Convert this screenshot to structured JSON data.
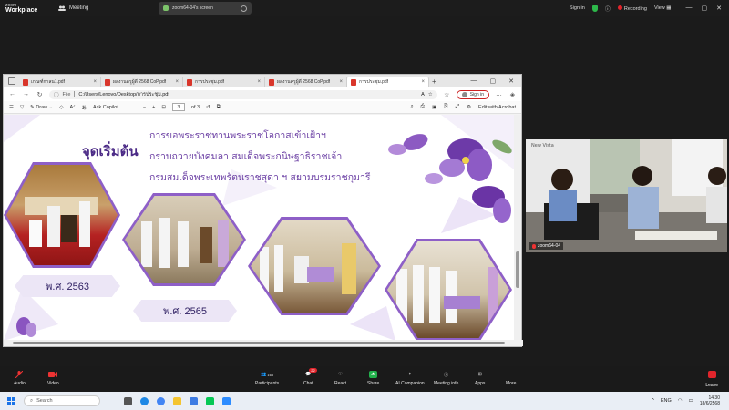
{
  "zoom": {
    "logo_small": "zoom",
    "logo_big": "Workplace",
    "meeting_tab": "Meeting",
    "share_tab": "zoom64-04's screen",
    "sign_in": "Sign in",
    "recording": "Recording",
    "view": "View"
  },
  "browser": {
    "tabs": [
      {
        "label": "เกณฑ์กาลน1.pdf"
      },
      {
        "label": "ผลงานครูผู้ดี 2568 CoP.pdf"
      },
      {
        "label": "การประชุม.pdf"
      },
      {
        "label": "ผลงานครูผู้ดี 2568 CoP.pdf"
      },
      {
        "label": "การประชุม.pdf"
      }
    ],
    "address_label": "File",
    "address_value": "C:/Users/Lenovo/Desktop/การประชุม.pdf",
    "signin": "Sign in",
    "toolbar": {
      "draw": "Draw",
      "ask_copilot": "Ask Copilot",
      "page_current": "3",
      "page_total": "of 3",
      "edit_acrobat": "Edit with Acrobat"
    }
  },
  "slide": {
    "heading": "จุดเริ่มต้น",
    "lines": [
      "การขอพระราชทานพระราชโอกาสเข้าเฝ้าฯ",
      "กราบถวายบังคมลา สมเด็จพระกนิษฐาธิราชเจ้า",
      "กรมสมเด็จพระเทพรัตนราชสุดา ฯ สยามบรมราชกุมารี"
    ],
    "year1": "พ.ศ. 2563",
    "year2": "พ.ศ. 2565"
  },
  "video": {
    "participant_name": "zoom64-04",
    "sign_text": "New Vista"
  },
  "controls": {
    "audio": "Audio",
    "video": "Video",
    "participants": "Participants",
    "participant_count": "165",
    "chat": "Chat",
    "chat_badge": "22",
    "react": "React",
    "share": "Share",
    "ai_companion": "AI Companion",
    "meeting_info": "Meeting info",
    "apps": "Apps",
    "more": "More",
    "leave": "Leave"
  },
  "taskbar": {
    "search": "Search",
    "lang": "ENG",
    "time": "14:30",
    "date": "18/6/2568"
  }
}
